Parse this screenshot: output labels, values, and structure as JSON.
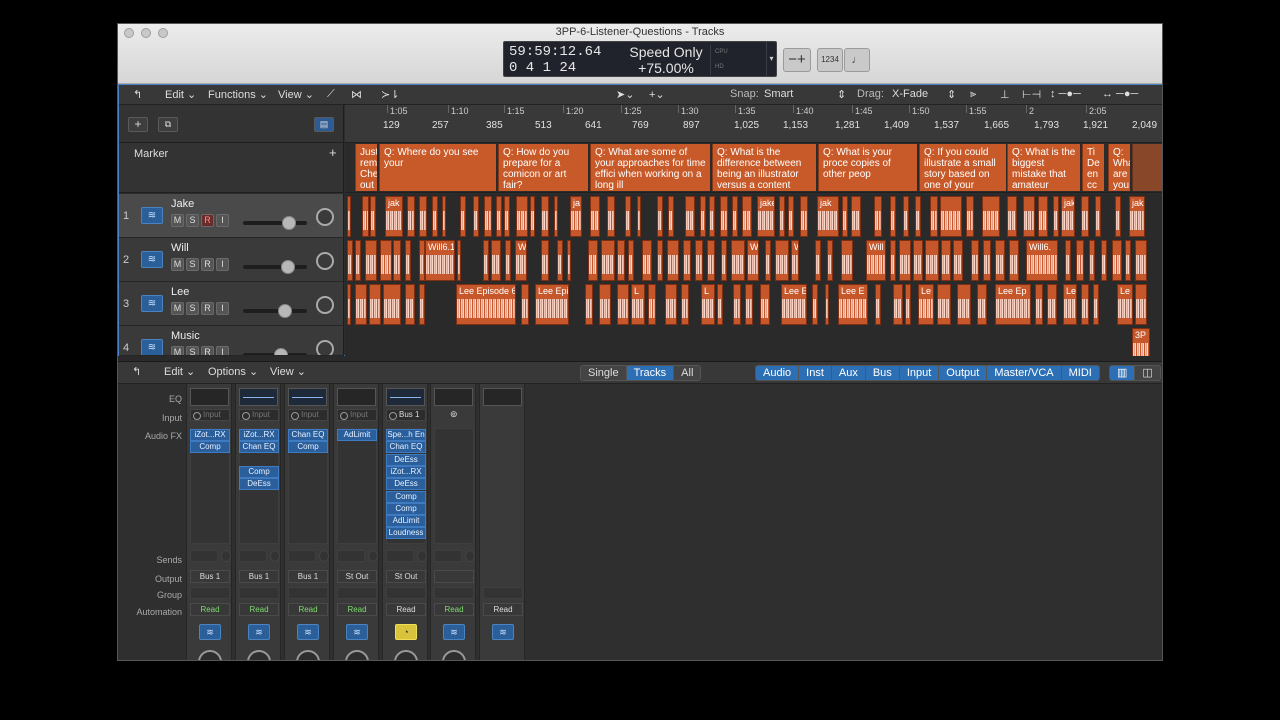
{
  "window": {
    "title": "3PP-6-Listener-Questions - Tracks"
  },
  "lcd": {
    "time": "59:59:12.64",
    "bars": "0  4  1   24",
    "mode": "Speed Only",
    "speed": "+75.00%",
    "cpu_label": "CPU",
    "hd_label": "HD"
  },
  "toolbar": {
    "minus_plus": "−+",
    "count_in": "1234",
    "metronome": "𝅘𝅥"
  },
  "tracks_menu": {
    "edit": "Edit",
    "functions": "Functions",
    "view": "View",
    "snap_label": "Snap:",
    "snap_value": "Smart",
    "drag_label": "Drag:",
    "drag_value": "X-Fade"
  },
  "ruler": {
    "time": [
      "1:05",
      "1:10",
      "1:15",
      "1:20",
      "1:25",
      "1:30",
      "1:35",
      "1:40",
      "1:45",
      "1:50",
      "1:55",
      "2",
      "2:05"
    ],
    "bars": [
      "129",
      "257",
      "385",
      "513",
      "641",
      "769",
      "897",
      "1,025",
      "1,153",
      "1,281",
      "1,409",
      "1,537",
      "1,665",
      "1,793",
      "1,921",
      "2,049"
    ]
  },
  "marker_track": {
    "label": "Marker"
  },
  "markers": [
    {
      "text": "Just rem Che out"
    },
    {
      "text": "Q: Where do you see your"
    },
    {
      "text": "Q: How do you prepare for a comicon or art fair?"
    },
    {
      "text": "Q: What are some of your approaches for time effici when working on a long ill"
    },
    {
      "text": "Q: What is the difference between being an illustrator versus a content"
    },
    {
      "text": "Q: What is your proce copies of other peop"
    },
    {
      "text": "Q: If you could illustrate a small story based on one of your favorite"
    },
    {
      "text": "Q: What is the biggest mistake that amateur illustrators"
    },
    {
      "text": "Ti De en cc"
    },
    {
      "text": "Q: Wha are you"
    }
  ],
  "tracks": [
    {
      "num": "1",
      "name": "Jake",
      "m": "M",
      "s": "S",
      "r": "R",
      "i": "I",
      "fader": 0.72
    },
    {
      "num": "2",
      "name": "Will",
      "m": "M",
      "s": "S",
      "r": "R",
      "i": "I",
      "fader": 0.7
    },
    {
      "num": "3",
      "name": "Lee",
      "m": "M",
      "s": "S",
      "r": "R",
      "i": "I",
      "fader": 0.66
    },
    {
      "num": "4",
      "name": "Music",
      "m": "M",
      "s": "S",
      "r": "R",
      "i": "I",
      "fader": 0.6
    }
  ],
  "regions": {
    "jake": "jak",
    "jake2": "ja",
    "jake3": "jake",
    "will": "Will6.11",
    "will2": "Wi",
    "will3": "W",
    "will4": "Will",
    "will5": "Will6.",
    "lee": "Lee Episode 6.",
    "lee2": "Lee Epi",
    "lee3": "L",
    "lee4": "Lee E",
    "lee5": "Le",
    "lee6": "Lee Ep",
    "music": "3P"
  },
  "mixer": {
    "edit": "Edit",
    "options": "Options",
    "view": "View",
    "views": [
      "Single",
      "Tracks",
      "All"
    ],
    "filters": [
      "Audio",
      "Inst",
      "Aux",
      "Bus",
      "Input",
      "Output",
      "Master/VCA",
      "MIDI"
    ],
    "rows": {
      "eq": "EQ",
      "input": "Input",
      "audiofx": "Audio FX",
      "sends": "Sends",
      "output": "Output",
      "group": "Group",
      "automation": "Automation"
    },
    "strips": [
      {
        "input": "Input",
        "fx": [
          "iZot...RX",
          "Comp"
        ],
        "output": "Bus 1",
        "auto": "Read"
      },
      {
        "input": "Input",
        "fx": [
          "iZot...RX",
          "Chan EQ",
          "",
          "Comp",
          "DeEss"
        ],
        "output": "Bus 1",
        "auto": "Read"
      },
      {
        "input": "Input",
        "fx": [
          "Chan EQ",
          "Comp"
        ],
        "output": "Bus 1",
        "auto": "Read"
      },
      {
        "input": "Input",
        "fx": [
          "AdLimit"
        ],
        "output": "St Out",
        "auto": "Read"
      },
      {
        "input": "Bus 1",
        "fx": [
          "Spe...h En",
          "Chan EQ",
          "DeEss",
          "iZot...RX",
          "DeEss",
          "Comp",
          "Comp",
          "AdLimit",
          "Loudness"
        ],
        "output": "St Out",
        "auto": "Read"
      },
      {
        "input": "",
        "fx": [],
        "output": "",
        "auto": "Read"
      },
      {
        "input": "",
        "fx": [],
        "output": "",
        "auto": "Read"
      }
    ]
  },
  "colors": {
    "region": "#c6572a",
    "accent": "#2d6fb5",
    "auto_green": "#7edc6e"
  }
}
